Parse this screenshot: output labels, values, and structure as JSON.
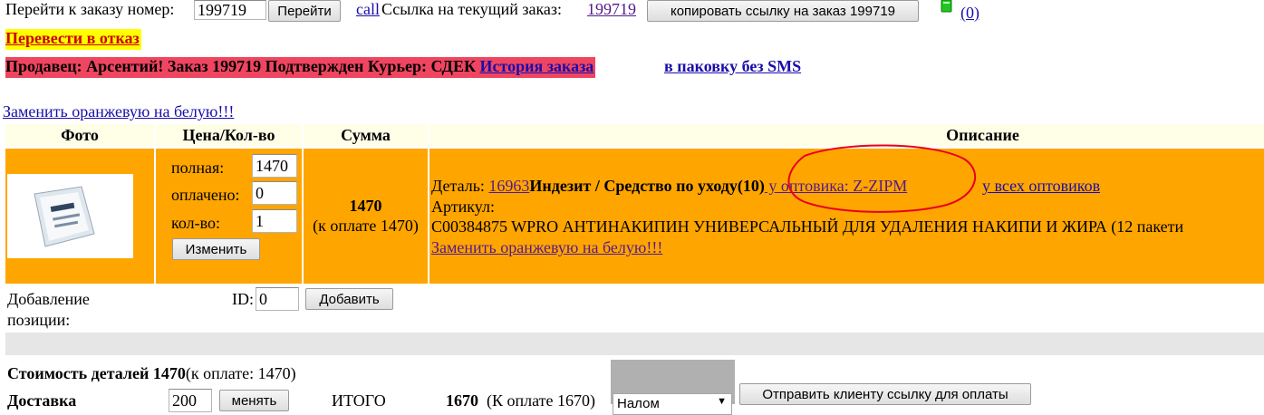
{
  "nav": {
    "goto_label": "Перейти к заказу номер:",
    "order_input_value": "199719",
    "goto_button": "Перейти",
    "call_link": "call",
    "current_link_label": "Ссылка на текущий заказ:",
    "current_order_link": "199719",
    "copy_button": "копировать ссылку на заказ 199719",
    "messages_count": "(0)"
  },
  "colors": {
    "alert_bg": "#ffff00",
    "status_bg": "#ef4560",
    "row_bg": "#ffa500",
    "header_bg": "#ffffe8",
    "annotation": "#e8001c"
  },
  "refuse_link": "Перевести в отказ",
  "status_bar": {
    "text": "Продавец: Арсентий! Заказ 199719 Подтвержден Курьер: СДЕК",
    "history_link": "История заказа",
    "packing_link": "в паковку без SMS"
  },
  "replace_link_top": "Заменить оранжевую на белую!!!",
  "table": {
    "headers": {
      "photo": "Фото",
      "price": "Цена/Кол-во",
      "sum": "Сумма",
      "desc": "Описание"
    },
    "row": {
      "full_label": "полная:",
      "full_value": "1470",
      "paid_label": "оплачено:",
      "paid_value": "0",
      "qty_label": "кол-во:",
      "qty_value": "1",
      "change_button": "Изменить",
      "sum_value": "1470",
      "sum_note": "(к оплате 1470)",
      "detail_label": "Деталь:",
      "detail_link": "16963",
      "detail_title": "Индезит / Средство по уходу(10)",
      "supplier_link": " у оптовика: Z-ZIPM",
      "all_suppliers_link": "у всех оптовиков",
      "article_label": "Артикул:",
      "description": "C00384875 WPRO АНТИНАКИПИН УНИВЕРСАЛЬНЫЙ ДЛЯ УДАЛЕНИЯ НАКИПИ И ЖИРА (12 пакети",
      "replace_link": "Заменить оранжевую на белую!!!"
    }
  },
  "add_position": {
    "label_line1": "Добавление",
    "label_line2": "позиции:",
    "id_label": "ID:",
    "id_value": "0",
    "add_button": "Добавить"
  },
  "totals": {
    "parts_cost_label": "Стоимость деталей 1470",
    "parts_cost_note": "(к оплате: 1470)",
    "delivery_label": "Доставка",
    "delivery_value": "200",
    "change_button": "менять",
    "total_label": "ИТОГО",
    "total_value": "1670",
    "total_note": "(К оплате 1670)",
    "payment_select": "Налом",
    "send_button": "Отправить клиенту ссылку для оплаты"
  }
}
